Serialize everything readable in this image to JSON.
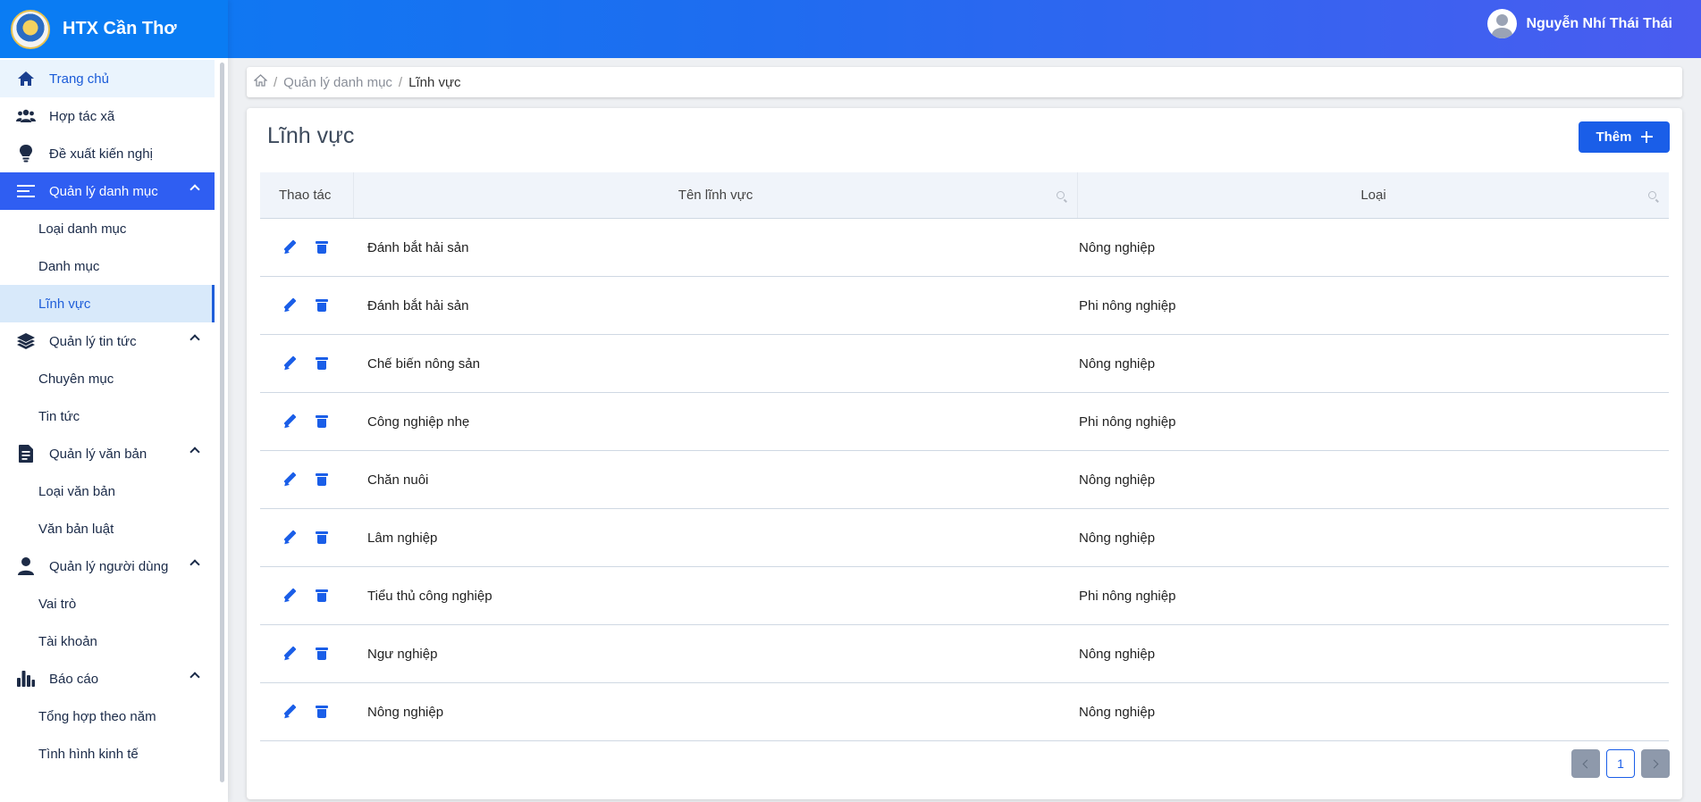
{
  "app": {
    "brand": "HTX Cần Thơ"
  },
  "header": {
    "user_name": "Nguyễn Nhí Thái Thái"
  },
  "sidebar": {
    "home": "Trang chủ",
    "htx": "Hợp tác xã",
    "proposal": "Đề xuất kiến nghị",
    "catalog": {
      "label": "Quản lý danh mục",
      "items": [
        "Loại danh mục",
        "Danh mục",
        "Lĩnh vực"
      ]
    },
    "news": {
      "label": "Quản lý tin tức",
      "items": [
        "Chuyên mục",
        "Tin tức"
      ]
    },
    "docs": {
      "label": "Quản lý văn bản",
      "items": [
        "Loại văn bản",
        "Văn bản luật"
      ]
    },
    "users": {
      "label": "Quản lý người dùng",
      "items": [
        "Vai trò",
        "Tài khoản"
      ]
    },
    "reports": {
      "label": "Báo cáo",
      "items": [
        "Tổng hợp theo năm",
        "Tình hình kinh tế"
      ]
    }
  },
  "breadcrumb": {
    "parent": "Quản lý danh mục",
    "current": "Lĩnh vực"
  },
  "page": {
    "title": "Lĩnh vực",
    "add_label": "Thêm"
  },
  "table": {
    "headers": [
      "Thao tác",
      "Tên lĩnh vực",
      "Loại"
    ],
    "rows": [
      [
        "Đánh bắt hải sản",
        "Nông nghiệp"
      ],
      [
        "Đánh bắt hải sản",
        "Phi nông nghiệp"
      ],
      [
        "Chế biến nông sản",
        "Nông nghiệp"
      ],
      [
        "Công nghiệp nhẹ",
        "Phi nông nghiệp"
      ],
      [
        "Chăn nuôi",
        "Nông nghiệp"
      ],
      [
        "Lâm nghiệp",
        "Nông nghiệp"
      ],
      [
        "Tiểu thủ công nghiệp",
        "Phi nông nghiệp"
      ],
      [
        "Ngư nghiệp",
        "Nông nghiệp"
      ],
      [
        "Nông nghiệp",
        "Nông nghiệp"
      ]
    ]
  },
  "pagination": {
    "current_page": "1"
  },
  "colors": {
    "primary": "#1a5ee8",
    "sidebar_active": "#2f5ef2",
    "header_gradient_start": "#0a7cf3",
    "header_gradient_end": "#4a5cf0"
  }
}
